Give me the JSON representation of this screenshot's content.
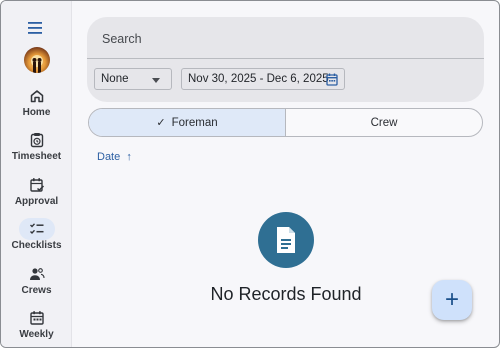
{
  "sidebar": {
    "items": [
      {
        "label": "Home",
        "icon": "home-icon"
      },
      {
        "label": "Timesheet",
        "icon": "timesheet-icon"
      },
      {
        "label": "Approval",
        "icon": "approval-icon"
      },
      {
        "label": "Checklists",
        "icon": "checklist-icon",
        "active": true
      },
      {
        "label": "Crews",
        "icon": "crews-icon"
      },
      {
        "label": "Weekly",
        "icon": "calendar-icon"
      }
    ]
  },
  "filters": {
    "search_placeholder": "Search",
    "select_value": "None",
    "date_range": "Nov 30, 2025 - Dec 6, 2025"
  },
  "toggle": {
    "left_label": "Foreman",
    "right_label": "Crew",
    "check_glyph": "✓"
  },
  "sort": {
    "label": "Date",
    "arrow": "↑"
  },
  "empty": {
    "message": "No Records Found"
  },
  "fab": {
    "glyph": "+"
  },
  "colors": {
    "accent": "#2c5fa3",
    "empty_circle": "#2f6f93",
    "active_nav": "#dfe8f7",
    "fab": "#cfe1fb"
  }
}
